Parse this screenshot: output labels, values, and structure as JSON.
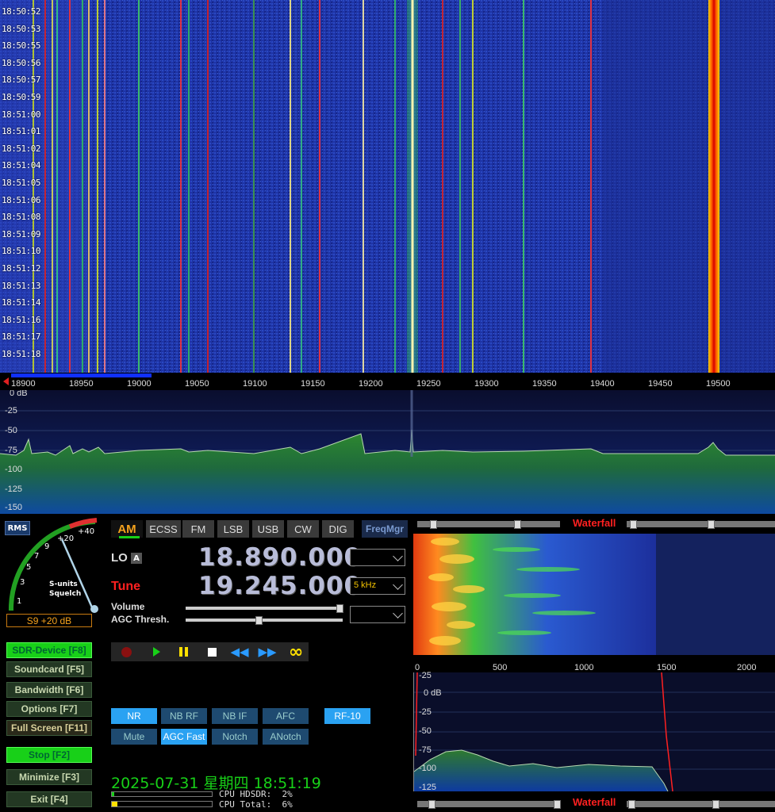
{
  "waterfall": {
    "times": [
      "18:50:52",
      "18:50:53",
      "18:50:55",
      "18:50:56",
      "18:50:57",
      "18:50:59",
      "18:51:00",
      "18:51:01",
      "18:51:02",
      "18:51:04",
      "18:51:05",
      "18:51:06",
      "18:51:08",
      "18:51:09",
      "18:51:10",
      "18:51:12",
      "18:51:13",
      "18:51:14",
      "18:51:16",
      "18:51:17",
      "18:51:18"
    ],
    "freq_ticks": [
      "18900",
      "18950",
      "19000",
      "19050",
      "19100",
      "19150",
      "19200",
      "19250",
      "19300",
      "19350",
      "19400",
      "19450",
      "19500"
    ]
  },
  "spectrum": {
    "db_labels": [
      "0 dB",
      "-25",
      "-50",
      "-75",
      "-100",
      "-125",
      "-150"
    ]
  },
  "smeter": {
    "rms_label": "RMS",
    "scale_labels": [
      "1",
      "3",
      "5",
      "7",
      "9",
      "+20",
      "+40"
    ],
    "caption_line1": "S-units",
    "caption_line2": "Squelch",
    "reading": "S9 +20 dB"
  },
  "modes": [
    "AM",
    "ECSS",
    "FM",
    "LSB",
    "USB",
    "CW",
    "DIG"
  ],
  "active_mode": "AM",
  "freqmgr_label": "FreqMgr",
  "lo": {
    "label": "LO",
    "badge": "A",
    "value": "18.890.000"
  },
  "tune": {
    "label": "Tune",
    "value": "19.245.000",
    "step": "5 kHz"
  },
  "controls": {
    "volume_label": "Volume",
    "agc_label": "AGC Thresh."
  },
  "left_buttons": [
    {
      "label": "SDR-Device [F8]",
      "active": true
    },
    {
      "label": "Soundcard  [F5]",
      "active": false
    },
    {
      "label": "Bandwidth  [F6]",
      "active": false
    },
    {
      "label": "Options    [F7]",
      "active": false
    },
    {
      "label": "Full Screen [F11]",
      "active": false
    },
    {
      "label": "Stop       [F2]",
      "active": true
    },
    {
      "label": "Minimize   [F3]",
      "active": false
    },
    {
      "label": "Exit       [F4]",
      "active": false
    }
  ],
  "dsp_row1": [
    "NR",
    "NB RF",
    "NB IF",
    "AFC"
  ],
  "dsp_row2": [
    "Mute",
    "AGC Fast",
    "Notch",
    "ANotch"
  ],
  "rf_label": "RF-10",
  "datetime": "2025-07-31 星期四 18:51:19",
  "cpu": {
    "hdsdr": "CPU HDSDR:  2%",
    "total": "CPU Total:  6%"
  },
  "audio": {
    "title_top": "Waterfall",
    "title_bottom": "Waterfall",
    "freq_ticks": [
      "0",
      "500",
      "1000",
      "1500",
      "2000"
    ],
    "db_labels": [
      "-25",
      "0 dB",
      "-25",
      "-50",
      "-75",
      "-100",
      "-125"
    ]
  },
  "colors": {
    "accent_orange": "#f5a21d",
    "tune_red": "#ff2020",
    "green_on": "#18d018",
    "waterfall_blue": "#1c2f9c"
  }
}
